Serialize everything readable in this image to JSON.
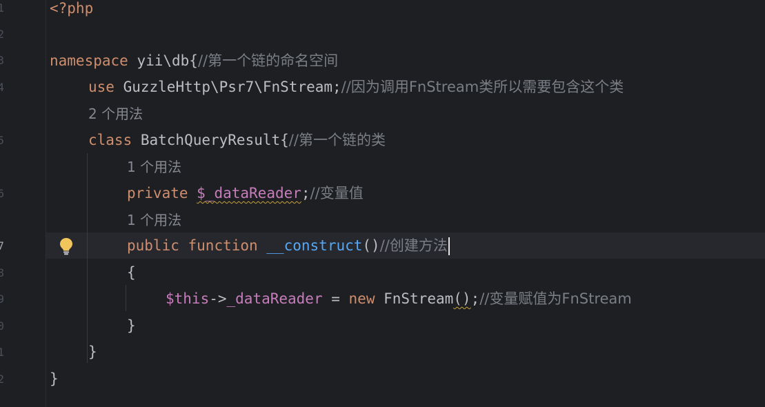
{
  "editor": {
    "line_numbers": [
      "1",
      "2",
      "3",
      "4",
      "5",
      "6",
      "7",
      "8",
      "9",
      "0",
      "1",
      "2"
    ],
    "lines": {
      "php_open": "<?php",
      "namespace_kw": "namespace",
      "namespace_name": " yii\\db{",
      "namespace_comment": "//第一个链的命名空间",
      "use_kw": "use",
      "use_path": " GuzzleHttp\\Psr7\\FnStream;",
      "use_comment": "//因为调用FnStream类所以需要包含这个类",
      "class_usages": "2 个用法",
      "class_kw": "class",
      "class_name": " BatchQueryResult{",
      "class_comment": "//第一个链的类",
      "prop_usages": "1 个用法",
      "private_kw": "private",
      "prop_name": "$_dataReader",
      "prop_end": ";",
      "prop_comment": "//变量值",
      "ctor_usages": "1 个用法",
      "public_kw": "public",
      "function_kw": "function",
      "ctor_name": "__construct",
      "ctor_parens": "()",
      "ctor_comment": "//创建方法",
      "open_brace": "{",
      "this_var": "$this",
      "arrow": "->",
      "this_prop": "_dataReader",
      "assign": " = ",
      "new_kw": "new",
      "new_class": " FnStream",
      "new_parens": "()",
      "stmt_end": ";",
      "assign_comment": "//变量赋值为FnStream",
      "close_method": "}",
      "close_class": "}",
      "close_namespace": "}"
    }
  },
  "colors": {
    "background": "#1e1f22",
    "keyword": "#cf8e6d",
    "variable": "#c77dbb",
    "function": "#56a8f5",
    "comment": "#7a7e85",
    "text": "#bcbec4"
  },
  "icons": {
    "intention_bulb": "lightbulb-icon"
  }
}
